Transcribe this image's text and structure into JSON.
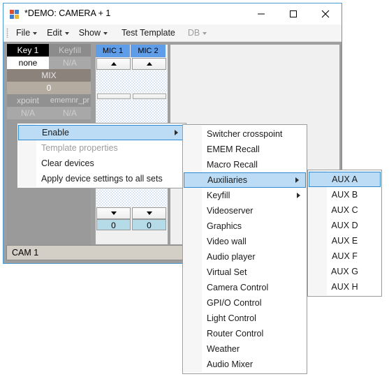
{
  "window": {
    "title": "*DEMO: CAMERA + 1",
    "icon": "app-window-icon",
    "minimize": "minimize-icon",
    "maximize": "maximize-icon",
    "close": "close-icon"
  },
  "menubar": {
    "items": [
      {
        "label": "File",
        "has_caret": true,
        "disabled": false
      },
      {
        "label": "Edit",
        "has_caret": true,
        "disabled": false
      },
      {
        "label": "Show",
        "has_caret": true,
        "disabled": false
      },
      {
        "label": "Test Template",
        "has_caret": false,
        "disabled": false
      },
      {
        "label": "DB",
        "has_caret": true,
        "disabled": true
      }
    ]
  },
  "keystack": {
    "key_label": "Key 1",
    "keyfill_label": "Keyfill",
    "key_value": "none",
    "keyfill_value": "N/A",
    "mix_label": "MIX",
    "mix_value": "0",
    "xpoint_label": "xpoint",
    "ememnr_label": "ememnr_pr",
    "xpoint_value": "N/A",
    "ememnr_value": "N/A"
  },
  "mic_panel": {
    "channels": [
      {
        "name": "MIC 1",
        "value": "0"
      },
      {
        "name": "MIC 2",
        "value": "0"
      }
    ]
  },
  "statusbar": {
    "text": "CAM 1"
  },
  "context_menu": {
    "items": [
      {
        "label": "Enable",
        "submenu": true,
        "disabled": false,
        "selected": true
      },
      {
        "label": "Template properties",
        "submenu": false,
        "disabled": true,
        "selected": false
      },
      {
        "label": "Clear devices",
        "submenu": false,
        "disabled": false,
        "selected": false
      },
      {
        "label": "Apply device settings to all sets",
        "submenu": false,
        "disabled": false,
        "selected": false
      }
    ]
  },
  "device_menu": {
    "items": [
      {
        "label": "Switcher crosspoint",
        "submenu": false,
        "selected": false
      },
      {
        "label": "EMEM Recall",
        "submenu": false,
        "selected": false
      },
      {
        "label": "Macro Recall",
        "submenu": false,
        "selected": false
      },
      {
        "label": "Auxiliaries",
        "submenu": true,
        "selected": true
      },
      {
        "label": "Keyfill",
        "submenu": true,
        "selected": false
      },
      {
        "label": "Videoserver",
        "submenu": false,
        "selected": false
      },
      {
        "label": "Graphics",
        "submenu": false,
        "selected": false
      },
      {
        "label": "Video wall",
        "submenu": false,
        "selected": false
      },
      {
        "label": "Audio player",
        "submenu": false,
        "selected": false
      },
      {
        "label": "Virtual Set",
        "submenu": false,
        "selected": false
      },
      {
        "label": "Camera Control",
        "submenu": false,
        "selected": false
      },
      {
        "label": "GPI/O Control",
        "submenu": false,
        "selected": false
      },
      {
        "label": "Light Control",
        "submenu": false,
        "selected": false
      },
      {
        "label": "Router Control",
        "submenu": false,
        "selected": false
      },
      {
        "label": "Weather",
        "submenu": false,
        "selected": false
      },
      {
        "label": "Audio Mixer",
        "submenu": false,
        "selected": false
      }
    ]
  },
  "aux_menu": {
    "items": [
      {
        "label": "AUX A",
        "selected": true
      },
      {
        "label": "AUX B",
        "selected": false
      },
      {
        "label": "AUX C",
        "selected": false
      },
      {
        "label": "AUX D",
        "selected": false
      },
      {
        "label": "AUX E",
        "selected": false
      },
      {
        "label": "AUX F",
        "selected": false
      },
      {
        "label": "AUX G",
        "selected": false
      },
      {
        "label": "AUX H",
        "selected": false
      }
    ]
  },
  "colors": {
    "window_border": "#4a9ad4",
    "menu_highlight": "#bcdcf5",
    "menu_highlight_border": "#2e8ad0",
    "mic_header": "#5f9de9",
    "mic_value_bg": "#b6dbe8",
    "statusbar_bg": "#d4cfc6"
  }
}
